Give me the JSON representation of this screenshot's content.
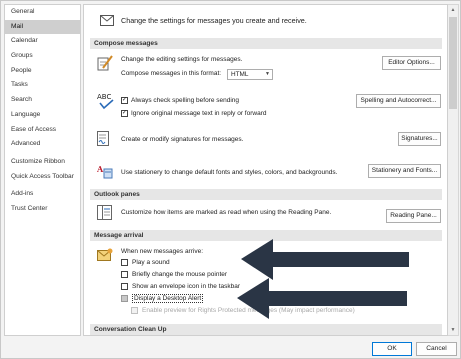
{
  "sidebar": {
    "items": [
      {
        "label": "General"
      },
      {
        "label": "Mail",
        "active": true
      },
      {
        "label": "Calendar"
      },
      {
        "label": "Groups"
      },
      {
        "label": "People"
      },
      {
        "label": "Tasks"
      },
      {
        "label": "Search"
      },
      {
        "label": "Language"
      },
      {
        "label": "Ease of Access"
      },
      {
        "label": "Advanced"
      },
      {
        "label": "Customize Ribbon"
      },
      {
        "label": "Quick Access Toolbar"
      },
      {
        "label": "Add-ins"
      },
      {
        "label": "Trust Center"
      }
    ]
  },
  "header": {
    "icon": "envelope-icon",
    "text": "Change the settings for messages you create and receive."
  },
  "compose": {
    "section_title": "Compose messages",
    "editing_text": "Change the editing settings for messages.",
    "editor_button": "Editor Options...",
    "format_label": "Compose messages in this format:",
    "format_value": "HTML",
    "spell_check_label": "Always check spelling before sending",
    "spell_check_checked": true,
    "ignore_original_label": "Ignore original message text in reply or forward",
    "ignore_original_checked": true,
    "spelling_button": "Spelling and Autocorrect...",
    "signatures_text": "Create or modify signatures for messages.",
    "signatures_button": "Signatures...",
    "stationery_text": "Use stationery to change default fonts and styles, colors, and backgrounds.",
    "stationery_button": "Stationery and Fonts..."
  },
  "outlook_panes": {
    "section_title": "Outlook panes",
    "text": "Customize how items are marked as read when using the Reading Pane.",
    "button": "Reading Pane..."
  },
  "message_arrival": {
    "section_title": "Message arrival",
    "intro": "When new messages arrive:",
    "play_sound": "Play a sound",
    "change_pointer": "Briefly change the mouse pointer",
    "envelope_icon": "Show an envelope icon in the taskbar",
    "desktop_alert": "Display a Desktop Alert",
    "enable_preview": "Enable preview for Rights Protected messages (May impact performance)"
  },
  "conversation": {
    "section_title": "Conversation Clean Up"
  },
  "footer": {
    "ok": "OK",
    "cancel": "Cancel"
  },
  "colors": {
    "arrow": "#2a3545",
    "section_bg": "#e6e6e6",
    "active_nav": "#cfcfcf"
  }
}
